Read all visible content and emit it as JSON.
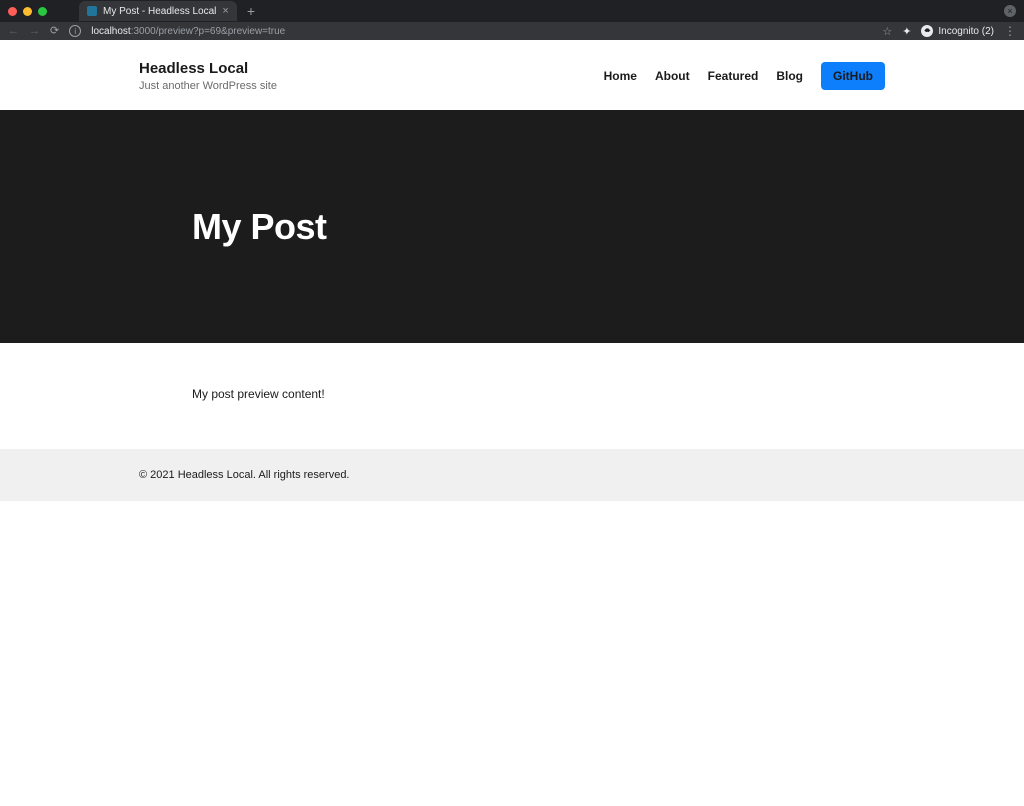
{
  "browser": {
    "tab_title": "My Post - Headless Local",
    "url_host": "localhost",
    "url_rest": ":3000/preview?p=69&preview=true",
    "incognito_label": "Incognito (2)"
  },
  "header": {
    "site_title": "Headless Local",
    "tagline": "Just another WordPress site",
    "nav": {
      "home": "Home",
      "about": "About",
      "featured": "Featured",
      "blog": "Blog",
      "github": "GitHub"
    }
  },
  "hero": {
    "title": "My Post"
  },
  "content": {
    "body": "My post preview content!"
  },
  "footer": {
    "copyright": "© 2021 Headless Local. All rights reserved."
  }
}
